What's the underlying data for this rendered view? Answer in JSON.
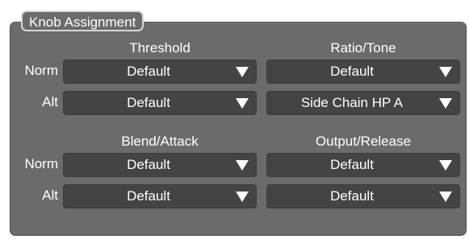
{
  "title": "Knob Assignment",
  "groups": [
    {
      "columns": [
        "Threshold",
        "Ratio/Tone"
      ],
      "rows": [
        {
          "label": "Norm",
          "values": [
            "Default",
            "Default"
          ]
        },
        {
          "label": "Alt",
          "values": [
            "Default",
            "Side Chain HP A"
          ]
        }
      ]
    },
    {
      "columns": [
        "Blend/Attack",
        "Output/Release"
      ],
      "rows": [
        {
          "label": "Norm",
          "values": [
            "Default",
            "Default"
          ]
        },
        {
          "label": "Alt",
          "values": [
            "Default",
            "Default"
          ]
        }
      ]
    }
  ],
  "icons": {
    "dropdown_arrow": "triangle-down-icon"
  },
  "colors": {
    "panel": "#6b6b6b",
    "dropdown": "#444444",
    "text": "#ffffff",
    "title_border": "#d8d8d8"
  }
}
